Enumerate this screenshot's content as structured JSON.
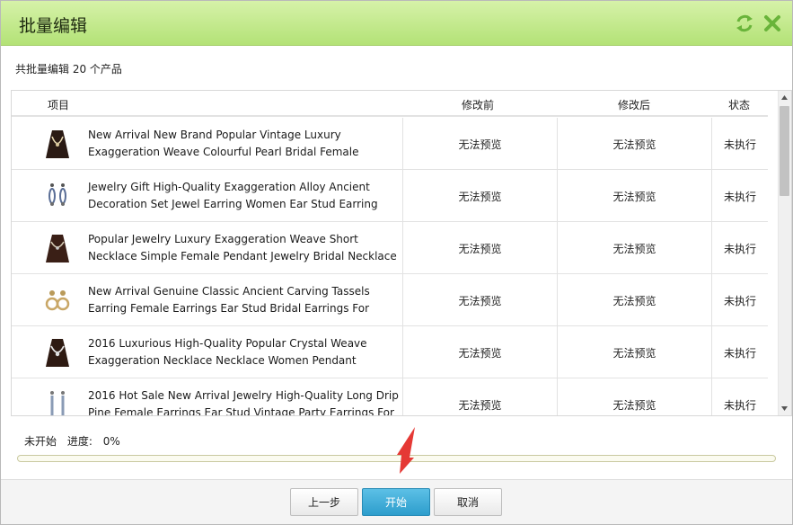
{
  "dialog": {
    "title": "批量编辑",
    "summary": "共批量编辑 20 个产品"
  },
  "icons": {
    "refresh": "refresh-icon",
    "close": "close-icon",
    "accent": "#69b43a"
  },
  "table": {
    "headers": {
      "item": "项目",
      "before": "修改前",
      "after": "修改后",
      "status": "状态"
    },
    "rows": [
      {
        "name": "New Arrival New Brand Popular Vintage Luxury Exaggeration Weave Colourful Pearl Bridal Female",
        "before": "无法预览",
        "after": "无法预览",
        "status": "未执行",
        "thumb": "necklace-icon"
      },
      {
        "name": "Jewelry Gift High-Quality Exaggeration Alloy Ancient Decoration Set Jewel Earring Women Ear Stud Earring",
        "before": "无法预览",
        "after": "无法预览",
        "status": "未执行",
        "thumb": "earring-icon"
      },
      {
        "name": "Popular Jewelry Luxury Exaggeration Weave Short Necklace Simple Female Pendant Jewelry Bridal Necklace",
        "before": "无法预览",
        "after": "无法预览",
        "status": "未执行",
        "thumb": "necklace-icon"
      },
      {
        "name": "New Arrival Genuine Classic Ancient Carving Tassels Earring Female Earrings Ear Stud Bridal Earrings For",
        "before": "无法预览",
        "after": "无法预览",
        "status": "未执行",
        "thumb": "earring-icon"
      },
      {
        "name": "2016 Luxurious High-Quality Popular Crystal Weave Exaggeration Necklace Necklace Women Pendant",
        "before": "无法预览",
        "after": "无法预览",
        "status": "未执行",
        "thumb": "necklace-icon"
      },
      {
        "name": "2016 Hot Sale New Arrival Jewelry High-Quality Long Drip Pine Female Earrings Ear Stud Vintage Party Earrings For",
        "before": "无法预览",
        "after": "无法预览",
        "status": "未执行",
        "thumb": "earring-icon"
      }
    ]
  },
  "progress": {
    "state": "未开始",
    "label": "进度:",
    "value_text": "0%",
    "value": 0
  },
  "buttons": {
    "prev": "上一步",
    "start": "开始",
    "cancel": "取消"
  }
}
